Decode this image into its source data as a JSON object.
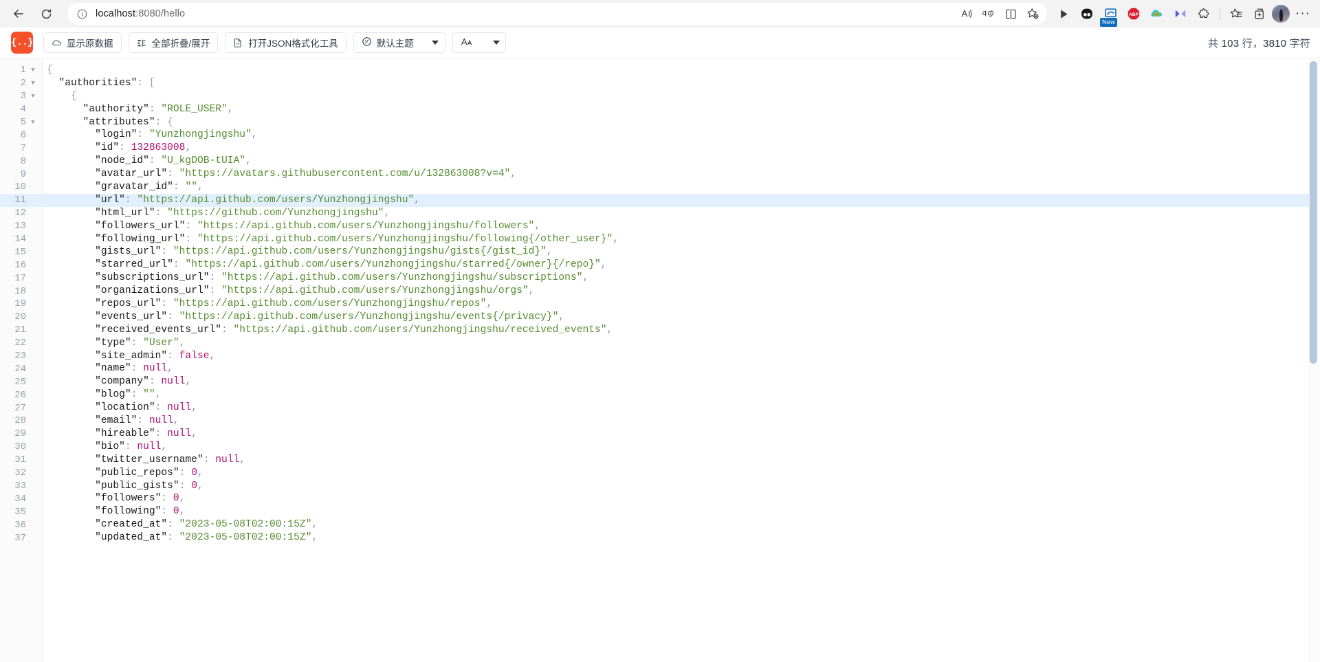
{
  "browser": {
    "back_icon": "back-arrow-icon",
    "reload_icon": "reload-icon",
    "info_icon": "info-circle-icon",
    "url_host": "localhost",
    "url_rest": ":8080/hello",
    "url_full": "localhost:8080/hello",
    "address_actions": [
      {
        "name": "read-aloud-icon",
        "glyph": "A"
      },
      {
        "name": "translate-icon",
        "glyph": "aあ"
      },
      {
        "name": "split-screen-icon",
        "glyph": "split"
      },
      {
        "name": "add-favorite-icon",
        "glyph": "star-plus"
      }
    ],
    "extensions": [
      {
        "name": "play-extension-icon",
        "label": ""
      },
      {
        "name": "dualsafe-extension-icon",
        "label": ""
      },
      {
        "name": "screenshot-extension-icon",
        "label": "New"
      },
      {
        "name": "adblock-plus-extension-icon",
        "label": "ABP"
      },
      {
        "name": "colorful-cloud-extension-icon",
        "label": ""
      },
      {
        "name": "arrows-extension-icon",
        "label": ""
      },
      {
        "name": "puzzle-extensions-icon",
        "label": ""
      }
    ],
    "collections_icon": "favorites-list-icon",
    "tab-actions_icon": "add-collection-icon",
    "profile_name": "avatar",
    "settings_icon": "more-options-icon",
    "settings_glyph": "···"
  },
  "viewer": {
    "logo_text": "{..}",
    "buttons": [
      {
        "id": "raw-data",
        "label": "显示原数据",
        "icon": "cloud-icon"
      },
      {
        "id": "collapse-expand",
        "label": "全部折叠/展开",
        "icon": "collapse-icon"
      },
      {
        "id": "open-formatter",
        "label": "打开JSON格式化工具",
        "icon": "document-icon"
      }
    ],
    "theme_select": {
      "label": "默认主题",
      "icon": "palette-icon"
    },
    "font_select": {
      "label": "Aᴀ",
      "icon": "font-size-icon"
    },
    "counts": {
      "prefix": "共",
      "lines": "103",
      "mid": "行，",
      "chars": "3810",
      "suffix": "字符"
    },
    "highlight_line": 11
  },
  "code": {
    "lines": [
      {
        "n": 1,
        "fold": true,
        "indent": 0,
        "tokens": [
          {
            "t": "brace",
            "v": "{"
          }
        ]
      },
      {
        "n": 2,
        "fold": true,
        "indent": 1,
        "tokens": [
          {
            "t": "key",
            "v": "\"authorities\""
          },
          {
            "t": "punc",
            "v": ": "
          },
          {
            "t": "brace",
            "v": "["
          }
        ]
      },
      {
        "n": 3,
        "fold": true,
        "indent": 2,
        "tokens": [
          {
            "t": "brace",
            "v": "{"
          }
        ]
      },
      {
        "n": 4,
        "fold": false,
        "indent": 3,
        "tokens": [
          {
            "t": "key",
            "v": "\"authority\""
          },
          {
            "t": "punc",
            "v": ": "
          },
          {
            "t": "str",
            "v": "\"ROLE_USER\""
          },
          {
            "t": "punc",
            "v": ","
          }
        ]
      },
      {
        "n": 5,
        "fold": true,
        "indent": 3,
        "tokens": [
          {
            "t": "key",
            "v": "\"attributes\""
          },
          {
            "t": "punc",
            "v": ": "
          },
          {
            "t": "brace",
            "v": "{"
          }
        ]
      },
      {
        "n": 6,
        "fold": false,
        "indent": 4,
        "tokens": [
          {
            "t": "key",
            "v": "\"login\""
          },
          {
            "t": "punc",
            "v": ": "
          },
          {
            "t": "str",
            "v": "\"Yunzhongjingshu\""
          },
          {
            "t": "punc",
            "v": ","
          }
        ]
      },
      {
        "n": 7,
        "fold": false,
        "indent": 4,
        "tokens": [
          {
            "t": "key",
            "v": "\"id\""
          },
          {
            "t": "punc",
            "v": ": "
          },
          {
            "t": "num",
            "v": "132863008"
          },
          {
            "t": "punc",
            "v": ","
          }
        ]
      },
      {
        "n": 8,
        "fold": false,
        "indent": 4,
        "tokens": [
          {
            "t": "key",
            "v": "\"node_id\""
          },
          {
            "t": "punc",
            "v": ": "
          },
          {
            "t": "str",
            "v": "\"U_kgDOB-tUIA\""
          },
          {
            "t": "punc",
            "v": ","
          }
        ]
      },
      {
        "n": 9,
        "fold": false,
        "indent": 4,
        "tokens": [
          {
            "t": "key",
            "v": "\"avatar_url\""
          },
          {
            "t": "punc",
            "v": ": "
          },
          {
            "t": "str",
            "v": "\"https://avatars.githubusercontent.com/u/132863008?v=4\""
          },
          {
            "t": "punc",
            "v": ","
          }
        ]
      },
      {
        "n": 10,
        "fold": false,
        "indent": 4,
        "tokens": [
          {
            "t": "key",
            "v": "\"gravatar_id\""
          },
          {
            "t": "punc",
            "v": ": "
          },
          {
            "t": "str",
            "v": "\"\""
          },
          {
            "t": "punc",
            "v": ","
          }
        ]
      },
      {
        "n": 11,
        "fold": false,
        "indent": 4,
        "tokens": [
          {
            "t": "key",
            "v": "\"url\""
          },
          {
            "t": "punc",
            "v": ": "
          },
          {
            "t": "str",
            "v": "\"https://api.github.com/users/Yunzhongjingshu\""
          },
          {
            "t": "punc",
            "v": ","
          }
        ]
      },
      {
        "n": 12,
        "fold": false,
        "indent": 4,
        "tokens": [
          {
            "t": "key",
            "v": "\"html_url\""
          },
          {
            "t": "punc",
            "v": ": "
          },
          {
            "t": "str",
            "v": "\"https://github.com/Yunzhongjingshu\""
          },
          {
            "t": "punc",
            "v": ","
          }
        ]
      },
      {
        "n": 13,
        "fold": false,
        "indent": 4,
        "tokens": [
          {
            "t": "key",
            "v": "\"followers_url\""
          },
          {
            "t": "punc",
            "v": ": "
          },
          {
            "t": "str",
            "v": "\"https://api.github.com/users/Yunzhongjingshu/followers\""
          },
          {
            "t": "punc",
            "v": ","
          }
        ]
      },
      {
        "n": 14,
        "fold": false,
        "indent": 4,
        "tokens": [
          {
            "t": "key",
            "v": "\"following_url\""
          },
          {
            "t": "punc",
            "v": ": "
          },
          {
            "t": "str",
            "v": "\"https://api.github.com/users/Yunzhongjingshu/following{/other_user}\""
          },
          {
            "t": "punc",
            "v": ","
          }
        ]
      },
      {
        "n": 15,
        "fold": false,
        "indent": 4,
        "tokens": [
          {
            "t": "key",
            "v": "\"gists_url\""
          },
          {
            "t": "punc",
            "v": ": "
          },
          {
            "t": "str",
            "v": "\"https://api.github.com/users/Yunzhongjingshu/gists{/gist_id}\""
          },
          {
            "t": "punc",
            "v": ","
          }
        ]
      },
      {
        "n": 16,
        "fold": false,
        "indent": 4,
        "tokens": [
          {
            "t": "key",
            "v": "\"starred_url\""
          },
          {
            "t": "punc",
            "v": ": "
          },
          {
            "t": "str",
            "v": "\"https://api.github.com/users/Yunzhongjingshu/starred{/owner}{/repo}\""
          },
          {
            "t": "punc",
            "v": ","
          }
        ]
      },
      {
        "n": 17,
        "fold": false,
        "indent": 4,
        "tokens": [
          {
            "t": "key",
            "v": "\"subscriptions_url\""
          },
          {
            "t": "punc",
            "v": ": "
          },
          {
            "t": "str",
            "v": "\"https://api.github.com/users/Yunzhongjingshu/subscriptions\""
          },
          {
            "t": "punc",
            "v": ","
          }
        ]
      },
      {
        "n": 18,
        "fold": false,
        "indent": 4,
        "tokens": [
          {
            "t": "key",
            "v": "\"organizations_url\""
          },
          {
            "t": "punc",
            "v": ": "
          },
          {
            "t": "str",
            "v": "\"https://api.github.com/users/Yunzhongjingshu/orgs\""
          },
          {
            "t": "punc",
            "v": ","
          }
        ]
      },
      {
        "n": 19,
        "fold": false,
        "indent": 4,
        "tokens": [
          {
            "t": "key",
            "v": "\"repos_url\""
          },
          {
            "t": "punc",
            "v": ": "
          },
          {
            "t": "str",
            "v": "\"https://api.github.com/users/Yunzhongjingshu/repos\""
          },
          {
            "t": "punc",
            "v": ","
          }
        ]
      },
      {
        "n": 20,
        "fold": false,
        "indent": 4,
        "tokens": [
          {
            "t": "key",
            "v": "\"events_url\""
          },
          {
            "t": "punc",
            "v": ": "
          },
          {
            "t": "str",
            "v": "\"https://api.github.com/users/Yunzhongjingshu/events{/privacy}\""
          },
          {
            "t": "punc",
            "v": ","
          }
        ]
      },
      {
        "n": 21,
        "fold": false,
        "indent": 4,
        "tokens": [
          {
            "t": "key",
            "v": "\"received_events_url\""
          },
          {
            "t": "punc",
            "v": ": "
          },
          {
            "t": "str",
            "v": "\"https://api.github.com/users/Yunzhongjingshu/received_events\""
          },
          {
            "t": "punc",
            "v": ","
          }
        ]
      },
      {
        "n": 22,
        "fold": false,
        "indent": 4,
        "tokens": [
          {
            "t": "key",
            "v": "\"type\""
          },
          {
            "t": "punc",
            "v": ": "
          },
          {
            "t": "str",
            "v": "\"User\""
          },
          {
            "t": "punc",
            "v": ","
          }
        ]
      },
      {
        "n": 23,
        "fold": false,
        "indent": 4,
        "tokens": [
          {
            "t": "key",
            "v": "\"site_admin\""
          },
          {
            "t": "punc",
            "v": ": "
          },
          {
            "t": "bool",
            "v": "false"
          },
          {
            "t": "punc",
            "v": ","
          }
        ]
      },
      {
        "n": 24,
        "fold": false,
        "indent": 4,
        "tokens": [
          {
            "t": "key",
            "v": "\"name\""
          },
          {
            "t": "punc",
            "v": ": "
          },
          {
            "t": "null",
            "v": "null"
          },
          {
            "t": "punc",
            "v": ","
          }
        ]
      },
      {
        "n": 25,
        "fold": false,
        "indent": 4,
        "tokens": [
          {
            "t": "key",
            "v": "\"company\""
          },
          {
            "t": "punc",
            "v": ": "
          },
          {
            "t": "null",
            "v": "null"
          },
          {
            "t": "punc",
            "v": ","
          }
        ]
      },
      {
        "n": 26,
        "fold": false,
        "indent": 4,
        "tokens": [
          {
            "t": "key",
            "v": "\"blog\""
          },
          {
            "t": "punc",
            "v": ": "
          },
          {
            "t": "str",
            "v": "\"\""
          },
          {
            "t": "punc",
            "v": ","
          }
        ]
      },
      {
        "n": 27,
        "fold": false,
        "indent": 4,
        "tokens": [
          {
            "t": "key",
            "v": "\"location\""
          },
          {
            "t": "punc",
            "v": ": "
          },
          {
            "t": "null",
            "v": "null"
          },
          {
            "t": "punc",
            "v": ","
          }
        ]
      },
      {
        "n": 28,
        "fold": false,
        "indent": 4,
        "tokens": [
          {
            "t": "key",
            "v": "\"email\""
          },
          {
            "t": "punc",
            "v": ": "
          },
          {
            "t": "null",
            "v": "null"
          },
          {
            "t": "punc",
            "v": ","
          }
        ]
      },
      {
        "n": 29,
        "fold": false,
        "indent": 4,
        "tokens": [
          {
            "t": "key",
            "v": "\"hireable\""
          },
          {
            "t": "punc",
            "v": ": "
          },
          {
            "t": "null",
            "v": "null"
          },
          {
            "t": "punc",
            "v": ","
          }
        ]
      },
      {
        "n": 30,
        "fold": false,
        "indent": 4,
        "tokens": [
          {
            "t": "key",
            "v": "\"bio\""
          },
          {
            "t": "punc",
            "v": ": "
          },
          {
            "t": "null",
            "v": "null"
          },
          {
            "t": "punc",
            "v": ","
          }
        ]
      },
      {
        "n": 31,
        "fold": false,
        "indent": 4,
        "tokens": [
          {
            "t": "key",
            "v": "\"twitter_username\""
          },
          {
            "t": "punc",
            "v": ": "
          },
          {
            "t": "null",
            "v": "null"
          },
          {
            "t": "punc",
            "v": ","
          }
        ]
      },
      {
        "n": 32,
        "fold": false,
        "indent": 4,
        "tokens": [
          {
            "t": "key",
            "v": "\"public_repos\""
          },
          {
            "t": "punc",
            "v": ": "
          },
          {
            "t": "num",
            "v": "0"
          },
          {
            "t": "punc",
            "v": ","
          }
        ]
      },
      {
        "n": 33,
        "fold": false,
        "indent": 4,
        "tokens": [
          {
            "t": "key",
            "v": "\"public_gists\""
          },
          {
            "t": "punc",
            "v": ": "
          },
          {
            "t": "num",
            "v": "0"
          },
          {
            "t": "punc",
            "v": ","
          }
        ]
      },
      {
        "n": 34,
        "fold": false,
        "indent": 4,
        "tokens": [
          {
            "t": "key",
            "v": "\"followers\""
          },
          {
            "t": "punc",
            "v": ": "
          },
          {
            "t": "num",
            "v": "0"
          },
          {
            "t": "punc",
            "v": ","
          }
        ]
      },
      {
        "n": 35,
        "fold": false,
        "indent": 4,
        "tokens": [
          {
            "t": "key",
            "v": "\"following\""
          },
          {
            "t": "punc",
            "v": ": "
          },
          {
            "t": "num",
            "v": "0"
          },
          {
            "t": "punc",
            "v": ","
          }
        ]
      },
      {
        "n": 36,
        "fold": false,
        "indent": 4,
        "tokens": [
          {
            "t": "key",
            "v": "\"created_at\""
          },
          {
            "t": "punc",
            "v": ": "
          },
          {
            "t": "str",
            "v": "\"2023-05-08T02:00:15Z\""
          },
          {
            "t": "punc",
            "v": ","
          }
        ]
      },
      {
        "n": 37,
        "fold": false,
        "indent": 4,
        "tokens": [
          {
            "t": "key",
            "v": "\"updated_at\""
          },
          {
            "t": "punc",
            "v": ": "
          },
          {
            "t": "str",
            "v": "\"2023-05-08T02:00:15Z\""
          },
          {
            "t": "punc",
            "v": ","
          }
        ]
      }
    ]
  }
}
